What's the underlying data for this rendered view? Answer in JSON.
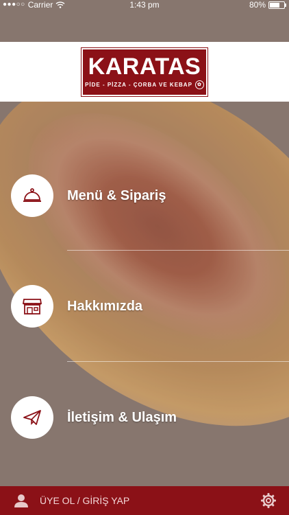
{
  "status_bar": {
    "carrier": "Carrier",
    "time": "1:43 pm",
    "battery": "80%",
    "battery_level": 0.8
  },
  "header": {
    "logo_brand": "KARATAS",
    "logo_tagline": "PİDE - PİZZA - ÇORBA VE KEBAP"
  },
  "menu": {
    "items": [
      {
        "label": "Menü & Sipariş",
        "icon": "cloche-icon"
      },
      {
        "label": "Hakkımızda",
        "icon": "storefront-icon"
      },
      {
        "label": "İletişim & Ulaşım",
        "icon": "paper-plane-icon"
      }
    ]
  },
  "bottom_bar": {
    "login_label": "ÜYE OL / GİRİŞ YAP"
  },
  "colors": {
    "brand_red": "#8b1117",
    "white": "#ffffff"
  }
}
